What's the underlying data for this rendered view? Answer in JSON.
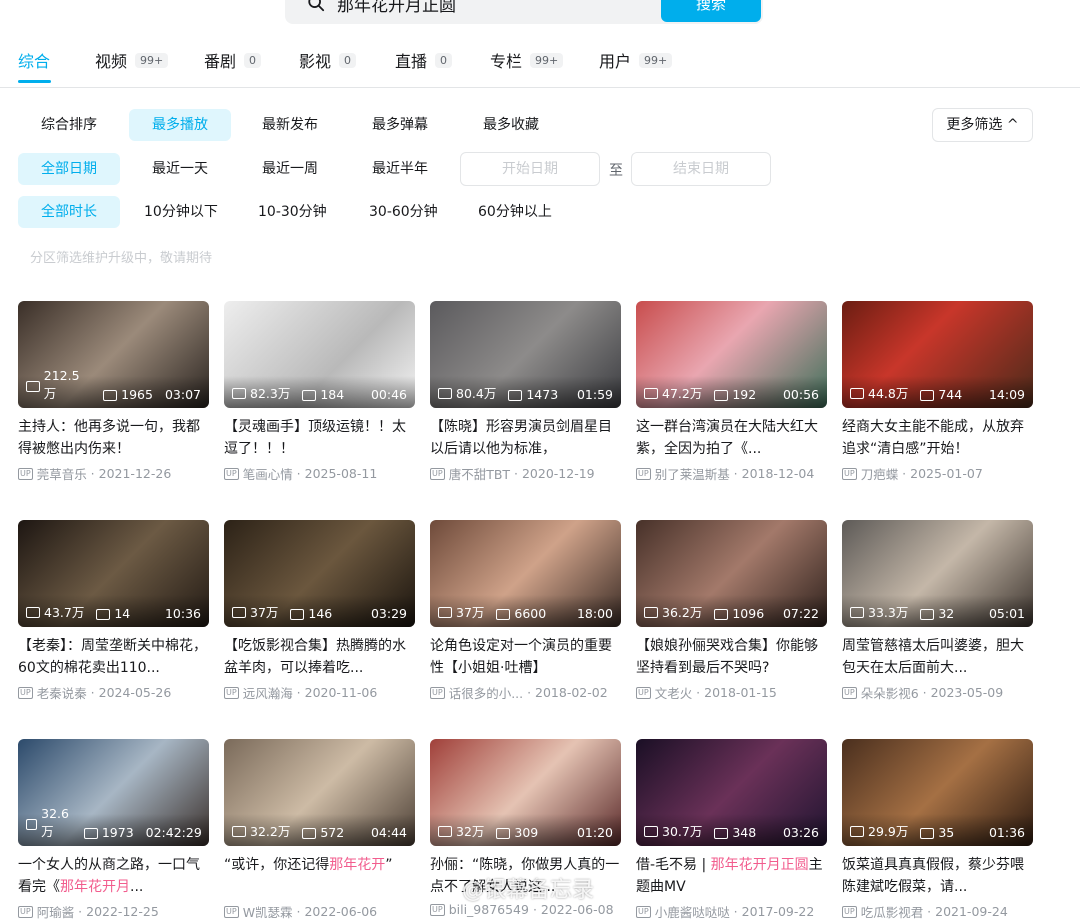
{
  "search": {
    "value": "那年花开月正圆",
    "button_label": "搜索"
  },
  "tabs": [
    {
      "label": "综合",
      "count": ""
    },
    {
      "label": "视频",
      "count": "99+"
    },
    {
      "label": "番剧",
      "count": "0"
    },
    {
      "label": "影视",
      "count": "0"
    },
    {
      "label": "直播",
      "count": "0"
    },
    {
      "label": "专栏",
      "count": "99+"
    },
    {
      "label": "用户",
      "count": "99+"
    }
  ],
  "sort_chips": [
    "综合排序",
    "最多播放",
    "最新发布",
    "最多弹幕",
    "最多收藏"
  ],
  "more_filter": "更多筛选",
  "date_chips": [
    "全部日期",
    "最近一天",
    "最近一周",
    "最近半年"
  ],
  "date_range": {
    "start_placeholder": "开始日期",
    "separator": "至",
    "end_placeholder": "结束日期"
  },
  "duration_chips": [
    "全部时长",
    "10分钟以下",
    "10-30分钟",
    "30-60分钟",
    "60分钟以上"
  ],
  "notice": "分区筛选维护升级中，敬请期待",
  "videos": [
    {
      "plays": "212.5万",
      "danmaku": "1965",
      "duration": "03:07",
      "title": "主持人：他再多说一句，我都得被憋出内伤来！",
      "author": "莞草音乐",
      "date": "2021-12-26"
    },
    {
      "plays": "82.3万",
      "danmaku": "184",
      "duration": "00:46",
      "title": "【灵魂画手】顶级运镜！！太逗了！！！",
      "author": "笔画心情",
      "date": "2025-08-11"
    },
    {
      "plays": "80.4万",
      "danmaku": "1473",
      "duration": "01:59",
      "title": "【陈晓】形容男演员剑眉星目以后请以他为标准，",
      "author": "唐不甜TBT",
      "date": "2020-12-19"
    },
    {
      "plays": "47.2万",
      "danmaku": "192",
      "duration": "00:56",
      "title": "这一群台湾演员在大陆大红大紫，全因为拍了《...",
      "author": "别了莱温斯基",
      "date": "2018-12-04"
    },
    {
      "plays": "44.8万",
      "danmaku": "744",
      "duration": "14:09",
      "title": "经商大女主能不能成，从放弃追求“清白感”开始！",
      "author": "刀疤蝶",
      "date": "2025-01-07"
    },
    {
      "plays": "43.7万",
      "danmaku": "14",
      "duration": "10:36",
      "title": "【老秦】：周莹垄断关中棉花，60文的棉花卖出110...",
      "author": "老秦说秦",
      "date": "2024-05-26"
    },
    {
      "plays": "37万",
      "danmaku": "146",
      "duration": "03:29",
      "title": "【吃饭影视合集】热腾腾的水盆羊肉，可以捧着吃...",
      "author": "远风瀚海",
      "date": "2020-11-06"
    },
    {
      "plays": "37万",
      "danmaku": "6600",
      "duration": "18:00",
      "title": "论角色设定对一个演员的重要性【小姐姐·吐槽】",
      "author": "话很多的小...",
      "date": "2018-02-02"
    },
    {
      "plays": "36.2万",
      "danmaku": "1096",
      "duration": "07:22",
      "title": "【娘娘孙俪哭戏合集】你能够坚持看到最后不哭吗?",
      "author": "文老火",
      "date": "2018-01-15"
    },
    {
      "plays": "33.3万",
      "danmaku": "32",
      "duration": "05:01",
      "title": "周莹管慈禧太后叫婆婆，胆大包天在太后面前大...",
      "author": "朵朵影视6",
      "date": "2023-05-09"
    },
    {
      "plays": "32.6万",
      "danmaku": "1973",
      "duration": "02:42:29",
      "title_pre": "一个女人的从商之路，一口气看完《",
      "title_hl": "那年花开月",
      "title_post": "...",
      "author": "阿瑜酱",
      "date": "2022-12-25"
    },
    {
      "plays": "32.2万",
      "danmaku": "572",
      "duration": "04:44",
      "title_pre": "“或许，你还记得",
      "title_hl": "那年花开",
      "title_post": "”",
      "author": "W凯瑟霖",
      "date": "2022-06-06"
    },
    {
      "plays": "32万",
      "danmaku": "309",
      "duration": "01:20",
      "title": "孙俪：“陈晓，你做男人真的一点不了解女人说这...",
      "author": "bili_9876549",
      "date": "2022-06-08"
    },
    {
      "plays": "30.7万",
      "danmaku": "348",
      "duration": "03:26",
      "title_pre": "借-毛不易 | ",
      "title_hl": "那年花开月正圆",
      "title_post": "主题曲MV",
      "author": "小鹿酱哒哒哒",
      "date": "2017-09-22"
    },
    {
      "plays": "29.9万",
      "danmaku": "35",
      "duration": "01:36",
      "title": "饭菜道具真真假假，蔡少芬喂陈建斌吃假菜，请...",
      "author": "吃瓜影视君",
      "date": "2021-09-24"
    }
  ],
  "watermark": "@银幕备忘录",
  "colors": {
    "accent": "#00aeec",
    "highlight": "#f25d8e",
    "muted": "#9499a0"
  }
}
